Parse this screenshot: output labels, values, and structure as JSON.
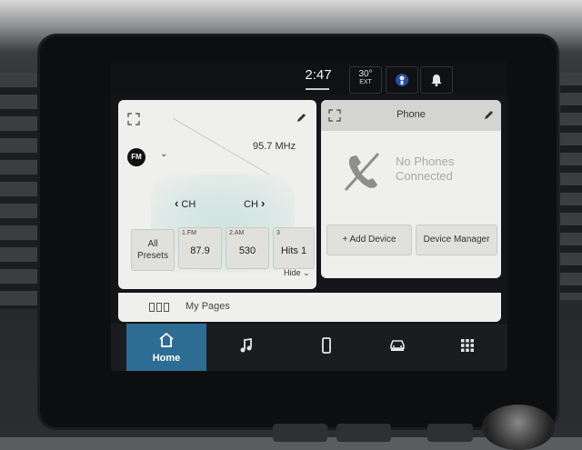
{
  "status_bar": {
    "time": "2:47",
    "temperature": "30°",
    "temperature_label": "EXT"
  },
  "radio": {
    "band": "FM",
    "frequency": "95.7 MHz",
    "channel_prev_label": "CH",
    "channel_next_label": "CH",
    "all_presets_line1": "All",
    "all_presets_line2": "Presets",
    "presets": [
      {
        "index_label": "1.FM",
        "value": "87.9"
      },
      {
        "index_label": "2.AM",
        "value": "530"
      },
      {
        "index_label": "3",
        "value": "Hits 1"
      }
    ],
    "hide_label": "Hide"
  },
  "phone": {
    "title": "Phone",
    "status_line1": "No Phones",
    "status_line2": "Connected",
    "add_device_label": "+ Add Device",
    "device_manager_label": "Device Manager"
  },
  "pages": {
    "my_pages_label": "My Pages"
  },
  "nav": {
    "home_label": "Home"
  }
}
